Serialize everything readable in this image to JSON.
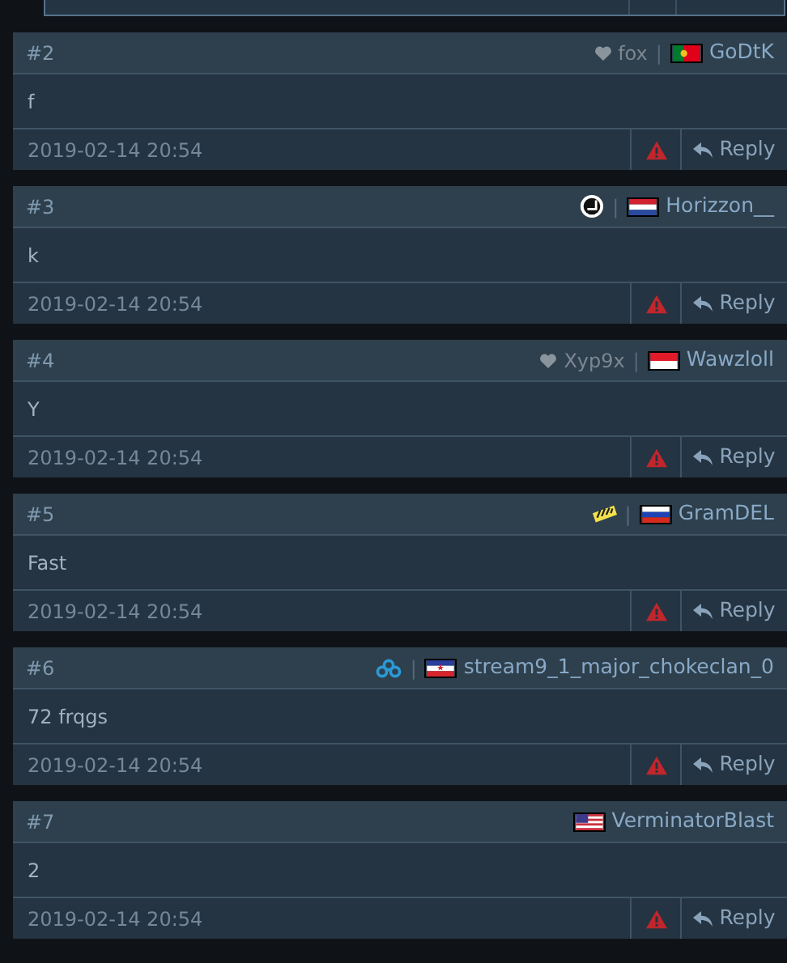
{
  "posts": [
    {
      "number": "#2",
      "badge": {
        "kind": "heart",
        "text": "fox"
      },
      "separator": "|",
      "flag": {
        "kind": "pt"
      },
      "username": "GoDtK",
      "text": "f",
      "date": "2019-02-14 20:54",
      "reply": "Reply"
    },
    {
      "number": "#3",
      "badge": {
        "kind": "round-logo"
      },
      "separator": "|",
      "flag": {
        "kind": "nl"
      },
      "username": "Horizzon__",
      "text": "k",
      "date": "2019-02-14 20:54",
      "reply": "Reply"
    },
    {
      "number": "#4",
      "badge": {
        "kind": "heart",
        "text": "Xyp9x"
      },
      "separator": "|",
      "flag": {
        "kind": "id"
      },
      "username": "Wawzloll",
      "text": "Y",
      "date": "2019-02-14 20:54",
      "reply": "Reply"
    },
    {
      "number": "#5",
      "badge": {
        "kind": "striped-logo"
      },
      "separator": "|",
      "flag": {
        "kind": "ru"
      },
      "username": "GramDEL",
      "text": "Fast",
      "date": "2019-02-14 20:54",
      "reply": "Reply"
    },
    {
      "number": "#6",
      "badge": {
        "kind": "knot-logo"
      },
      "separator": "|",
      "flag": {
        "kind": "yu"
      },
      "username": "stream9_1_major_chokeclan_0",
      "text": "72 frqgs",
      "date": "2019-02-14 20:54",
      "reply": "Reply"
    },
    {
      "number": "#7",
      "flag": {
        "kind": "us"
      },
      "username": "VerminatorBlast",
      "text": "2",
      "date": "2019-02-14 20:54",
      "reply": "Reply"
    }
  ]
}
